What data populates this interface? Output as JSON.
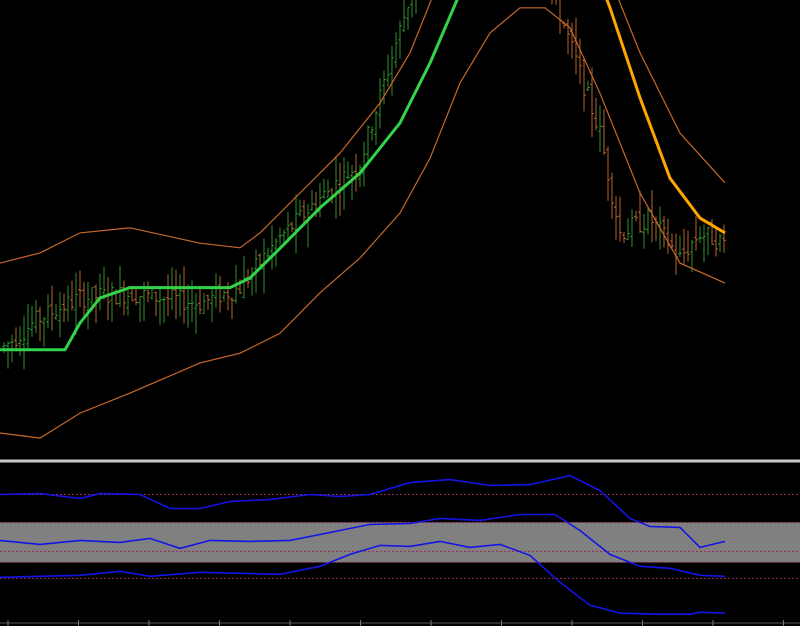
{
  "colors": {
    "background": "#000000",
    "candle_up": "#2f8f2f",
    "candle_down": "#b5652e",
    "envelope": "#c8692a",
    "ma_up": "#32d24a",
    "ma_down": "#ffa500",
    "separator": "#c8c8c8",
    "osc_line": "#1414e6",
    "osc_band": "#808080",
    "osc_level": "#9a2a5a"
  },
  "chart_data": [
    {
      "type": "candlestick",
      "panel": "price",
      "title": "",
      "grid": false,
      "legend": "none",
      "ylim": [
        0,
        100
      ],
      "ma_series": [
        {
          "x": 0,
          "y": 14.6
        },
        {
          "x": 20,
          "y": 14.6
        },
        {
          "x": 65,
          "y": 14.6
        },
        {
          "x": 80,
          "y": 19.3
        },
        {
          "x": 100,
          "y": 23.7
        },
        {
          "x": 130,
          "y": 25.5
        },
        {
          "x": 180,
          "y": 25.5
        },
        {
          "x": 230,
          "y": 25.5
        },
        {
          "x": 250,
          "y": 27.2
        },
        {
          "x": 280,
          "y": 32.4
        },
        {
          "x": 320,
          "y": 39.5
        },
        {
          "x": 360,
          "y": 45.6
        },
        {
          "x": 400,
          "y": 54.4
        },
        {
          "x": 430,
          "y": 64.9
        },
        {
          "x": 460,
          "y": 77.2
        },
        {
          "x": 490,
          "y": 85.1
        },
        {
          "x": 520,
          "y": 90.4
        },
        {
          "x": 525,
          "y": 98.2
        },
        {
          "x": 555,
          "y": 98.2
        },
        {
          "x": 580,
          "y": 88.6
        },
        {
          "x": 610,
          "y": 74.6
        },
        {
          "x": 640,
          "y": 58.8
        },
        {
          "x": 670,
          "y": 44.7
        },
        {
          "x": 700,
          "y": 37.7
        },
        {
          "x": 725,
          "y": 35.1
        }
      ],
      "ma_turn_x": 522,
      "envelope_upper": [
        {
          "x": 0,
          "y": 29.8
        },
        {
          "x": 40,
          "y": 31.6
        },
        {
          "x": 80,
          "y": 35.1
        },
        {
          "x": 130,
          "y": 36.0
        },
        {
          "x": 200,
          "y": 33.3
        },
        {
          "x": 240,
          "y": 32.5
        },
        {
          "x": 260,
          "y": 35.1
        },
        {
          "x": 300,
          "y": 42.1
        },
        {
          "x": 340,
          "y": 49.1
        },
        {
          "x": 380,
          "y": 57.9
        },
        {
          "x": 410,
          "y": 66.7
        },
        {
          "x": 440,
          "y": 79.8
        },
        {
          "x": 470,
          "y": 89.5
        },
        {
          "x": 500,
          "y": 96.5
        },
        {
          "x": 520,
          "y": 100.9
        },
        {
          "x": 545,
          "y": 102.6
        },
        {
          "x": 570,
          "y": 97.4
        },
        {
          "x": 600,
          "y": 84.2
        },
        {
          "x": 640,
          "y": 66.7
        },
        {
          "x": 680,
          "y": 52.6
        },
        {
          "x": 725,
          "y": 43.9
        }
      ],
      "envelope_lower": [
        {
          "x": 0,
          "y": 0.0
        },
        {
          "x": 40,
          "y": -0.9
        },
        {
          "x": 80,
          "y": 3.5
        },
        {
          "x": 130,
          "y": 7.0
        },
        {
          "x": 200,
          "y": 12.3
        },
        {
          "x": 240,
          "y": 14.0
        },
        {
          "x": 280,
          "y": 17.5
        },
        {
          "x": 320,
          "y": 24.6
        },
        {
          "x": 360,
          "y": 30.7
        },
        {
          "x": 400,
          "y": 38.6
        },
        {
          "x": 430,
          "y": 48.2
        },
        {
          "x": 460,
          "y": 61.4
        },
        {
          "x": 490,
          "y": 70.2
        },
        {
          "x": 520,
          "y": 74.6
        },
        {
          "x": 545,
          "y": 74.6
        },
        {
          "x": 570,
          "y": 71.1
        },
        {
          "x": 600,
          "y": 59.6
        },
        {
          "x": 640,
          "y": 42.1
        },
        {
          "x": 680,
          "y": 29.8
        },
        {
          "x": 725,
          "y": 26.3
        }
      ],
      "bars_step": 4,
      "bars_x_range": [
        4,
        724
      ],
      "bars_trend": [
        {
          "x": 0,
          "y": 14.6
        },
        {
          "x": 40,
          "y": 20.2
        },
        {
          "x": 80,
          "y": 23.7
        },
        {
          "x": 130,
          "y": 24.5
        },
        {
          "x": 200,
          "y": 22.8
        },
        {
          "x": 240,
          "y": 25.5
        },
        {
          "x": 280,
          "y": 34.2
        },
        {
          "x": 320,
          "y": 41.2
        },
        {
          "x": 360,
          "y": 47.4
        },
        {
          "x": 390,
          "y": 64.9
        },
        {
          "x": 420,
          "y": 82.5
        },
        {
          "x": 450,
          "y": 91.2
        },
        {
          "x": 490,
          "y": 96.5
        },
        {
          "x": 520,
          "y": 100.9
        },
        {
          "x": 540,
          "y": 84.2
        },
        {
          "x": 570,
          "y": 68.4
        },
        {
          "x": 600,
          "y": 52.6
        },
        {
          "x": 620,
          "y": 35.1
        },
        {
          "x": 650,
          "y": 37.7
        },
        {
          "x": 680,
          "y": 30.7
        },
        {
          "x": 700,
          "y": 35.1
        },
        {
          "x": 725,
          "y": 33.3
        }
      ]
    },
    {
      "type": "line",
      "panel": "oscillator",
      "title": "",
      "grid": false,
      "legend": "none",
      "ylim": [
        0,
        100
      ],
      "band": [
        22.6,
        60.4
      ],
      "levels": [
        86.8,
        33.0,
        7.5
      ],
      "series": [
        {
          "values": [
            {
              "x": 0,
              "y": 86.8
            },
            {
              "x": 40,
              "y": 87.7
            },
            {
              "x": 80,
              "y": 83.0
            },
            {
              "x": 100,
              "y": 87.7
            },
            {
              "x": 140,
              "y": 86.8
            },
            {
              "x": 170,
              "y": 73.6
            },
            {
              "x": 200,
              "y": 73.6
            },
            {
              "x": 230,
              "y": 80.2
            },
            {
              "x": 270,
              "y": 82.1
            },
            {
              "x": 310,
              "y": 86.8
            },
            {
              "x": 340,
              "y": 84.9
            },
            {
              "x": 370,
              "y": 86.8
            },
            {
              "x": 410,
              "y": 98.1
            },
            {
              "x": 450,
              "y": 100.9
            },
            {
              "x": 490,
              "y": 95.3
            },
            {
              "x": 530,
              "y": 96.2
            },
            {
              "x": 570,
              "y": 104.7
            },
            {
              "x": 600,
              "y": 90.6
            },
            {
              "x": 630,
              "y": 64.2
            },
            {
              "x": 650,
              "y": 56.6
            },
            {
              "x": 680,
              "y": 55.7
            },
            {
              "x": 700,
              "y": 36.8
            },
            {
              "x": 725,
              "y": 42.5
            }
          ]
        },
        {
          "values": [
            {
              "x": 0,
              "y": 43.4
            },
            {
              "x": 40,
              "y": 39.6
            },
            {
              "x": 80,
              "y": 43.4
            },
            {
              "x": 120,
              "y": 41.5
            },
            {
              "x": 150,
              "y": 45.3
            },
            {
              "x": 180,
              "y": 35.8
            },
            {
              "x": 210,
              "y": 43.4
            },
            {
              "x": 250,
              "y": 42.5
            },
            {
              "x": 290,
              "y": 43.4
            },
            {
              "x": 330,
              "y": 50.9
            },
            {
              "x": 370,
              "y": 58.5
            },
            {
              "x": 410,
              "y": 59.4
            },
            {
              "x": 440,
              "y": 64.2
            },
            {
              "x": 480,
              "y": 62.3
            },
            {
              "x": 520,
              "y": 67.9
            },
            {
              "x": 555,
              "y": 67.9
            },
            {
              "x": 580,
              "y": 52.8
            },
            {
              "x": 610,
              "y": 30.2
            },
            {
              "x": 640,
              "y": 18.9
            },
            {
              "x": 670,
              "y": 17.0
            },
            {
              "x": 700,
              "y": 10.4
            },
            {
              "x": 725,
              "y": 9.4
            }
          ]
        },
        {
          "values": [
            {
              "x": 0,
              "y": 8.5
            },
            {
              "x": 40,
              "y": 9.4
            },
            {
              "x": 80,
              "y": 10.4
            },
            {
              "x": 120,
              "y": 14.2
            },
            {
              "x": 150,
              "y": 9.4
            },
            {
              "x": 200,
              "y": 13.2
            },
            {
              "x": 240,
              "y": 12.3
            },
            {
              "x": 280,
              "y": 11.3
            },
            {
              "x": 320,
              "y": 18.9
            },
            {
              "x": 350,
              "y": 30.2
            },
            {
              "x": 380,
              "y": 38.7
            },
            {
              "x": 410,
              "y": 37.7
            },
            {
              "x": 440,
              "y": 42.5
            },
            {
              "x": 470,
              "y": 36.8
            },
            {
              "x": 500,
              "y": 39.6
            },
            {
              "x": 530,
              "y": 29.2
            },
            {
              "x": 560,
              "y": 3.8
            },
            {
              "x": 590,
              "y": -17.9
            },
            {
              "x": 620,
              "y": -25.5
            },
            {
              "x": 660,
              "y": -26.4
            },
            {
              "x": 690,
              "y": -26.4
            },
            {
              "x": 700,
              "y": -24.5
            },
            {
              "x": 725,
              "y": -25.5
            }
          ]
        }
      ],
      "xticks_count": 12
    }
  ]
}
